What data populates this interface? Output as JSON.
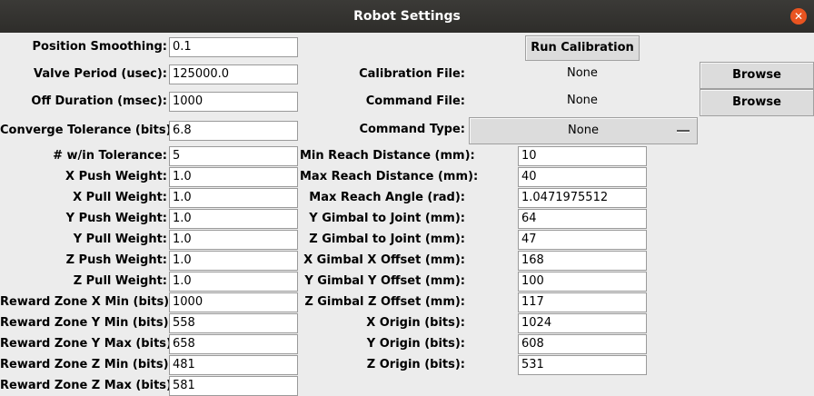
{
  "window": {
    "title": "Robot Settings"
  },
  "left_fields": [
    {
      "label": "Position Smoothing:",
      "value": "0.1"
    },
    {
      "label": "Valve Period (usec):",
      "value": "125000.0"
    },
    {
      "label": "Off Duration (msec):",
      "value": "1000"
    },
    {
      "label": "Converge Tolerance (bits):",
      "value": "6.8"
    },
    {
      "label": "# w/in Tolerance:",
      "value": "5"
    },
    {
      "label": "X Push Weight:",
      "value": "1.0"
    },
    {
      "label": "X Pull Weight:",
      "value": "1.0"
    },
    {
      "label": "Y Push Weight:",
      "value": "1.0"
    },
    {
      "label": "Y Pull Weight:",
      "value": "1.0"
    },
    {
      "label": "Z Push Weight:",
      "value": "1.0"
    },
    {
      "label": "Z Pull Weight:",
      "value": "1.0"
    },
    {
      "label": "Reward Zone X Min (bits):",
      "value": "1000"
    },
    {
      "label": "Reward Zone Y Min (bits):",
      "value": "558"
    },
    {
      "label": "Reward Zone Y Max (bits):",
      "value": "658"
    },
    {
      "label": "Reward Zone Z Min (bits):",
      "value": "481"
    },
    {
      "label": "Reward Zone Z Max (bits):",
      "value": "581"
    }
  ],
  "calibration": {
    "run_label": "Run Calibration",
    "file_label": "Calibration File:",
    "file_value": "None",
    "browse_label": "Browse"
  },
  "command": {
    "file_label": "Command File:",
    "file_value": "None",
    "browse_label": "Browse",
    "type_label": "Command Type:",
    "type_value": "None"
  },
  "right_fields": [
    {
      "label": "Min Reach Distance (mm):",
      "value": "10"
    },
    {
      "label": "Max Reach Distance (mm):",
      "value": "40"
    },
    {
      "label": "Max Reach Angle (rad):",
      "value": "1.0471975512"
    },
    {
      "label": "Y Gimbal to Joint (mm):",
      "value": "64"
    },
    {
      "label": "Z Gimbal to Joint (mm):",
      "value": "47"
    },
    {
      "label": "X Gimbal X Offset (mm):",
      "value": "168"
    },
    {
      "label": "Y Gimbal Y Offset (mm):",
      "value": "100"
    },
    {
      "label": "Z Gimbal Z Offset (mm):",
      "value": "117"
    },
    {
      "label": "X Origin (bits):",
      "value": "1024"
    },
    {
      "label": "Y Origin (bits):",
      "value": "608"
    },
    {
      "label": "Z Origin (bits):",
      "value": "531"
    }
  ]
}
